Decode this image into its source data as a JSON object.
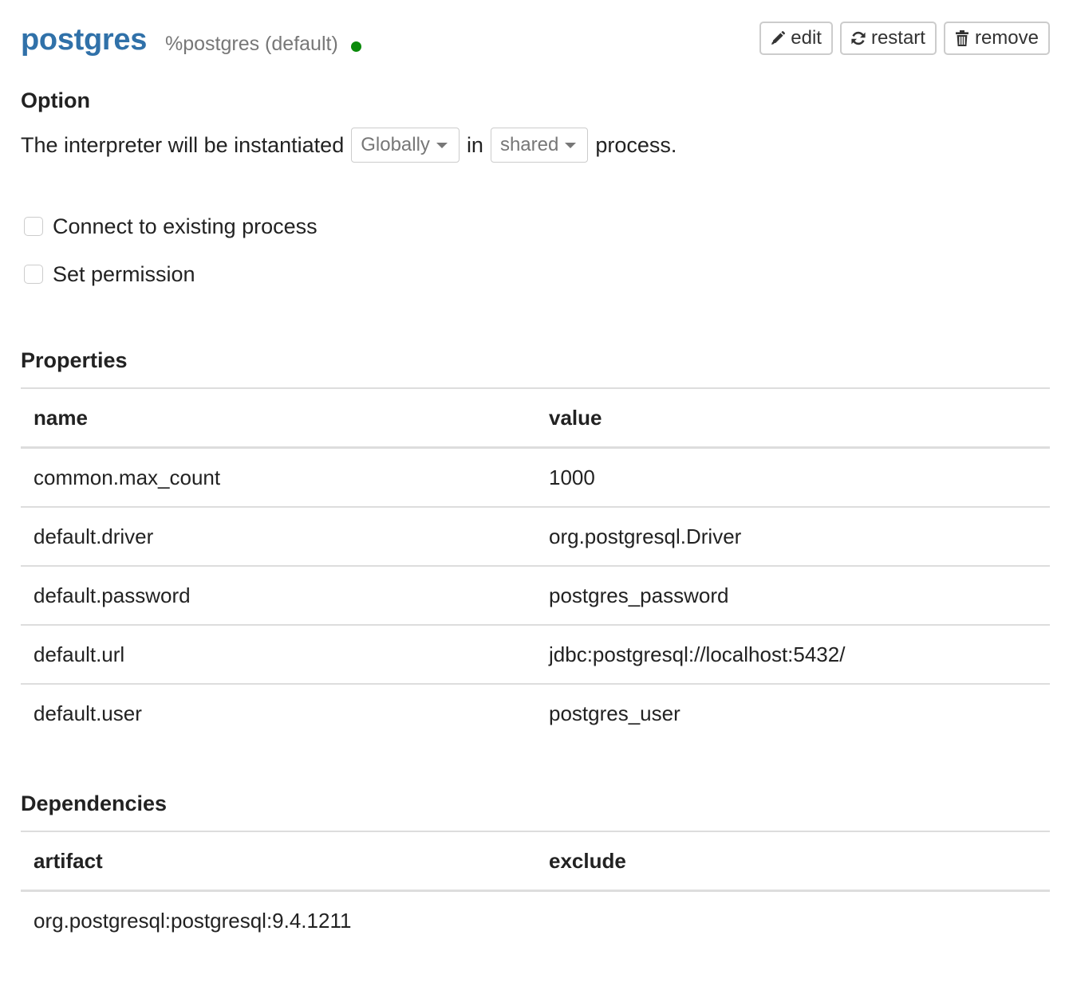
{
  "header": {
    "name": "postgres",
    "subtitle": "%postgres (default)",
    "status_color": "#0a8a0a",
    "buttons": [
      {
        "label": "edit",
        "icon": "pencil-icon"
      },
      {
        "label": "restart",
        "icon": "refresh-icon"
      },
      {
        "label": "remove",
        "icon": "trash-icon"
      }
    ]
  },
  "option": {
    "title": "Option",
    "sentence_prefix": "The interpreter will be instantiated",
    "scope_select": "Globally",
    "sentence_middle": "in",
    "process_select": "shared",
    "sentence_suffix": "process.",
    "checkboxes": [
      {
        "label": "Connect to existing process",
        "checked": false
      },
      {
        "label": "Set permission",
        "checked": false
      }
    ]
  },
  "properties": {
    "title": "Properties",
    "columns": [
      "name",
      "value"
    ],
    "rows": [
      {
        "name": "common.max_count",
        "value": "1000"
      },
      {
        "name": "default.driver",
        "value": "org.postgresql.Driver"
      },
      {
        "name": "default.password",
        "value": "postgres_password"
      },
      {
        "name": "default.url",
        "value": "jdbc:postgresql://localhost:5432/"
      },
      {
        "name": "default.user",
        "value": "postgres_user"
      }
    ]
  },
  "dependencies": {
    "title": "Dependencies",
    "columns": [
      "artifact",
      "exclude"
    ],
    "rows": [
      {
        "artifact": "org.postgresql:postgresql:9.4.1211",
        "exclude": ""
      }
    ]
  }
}
